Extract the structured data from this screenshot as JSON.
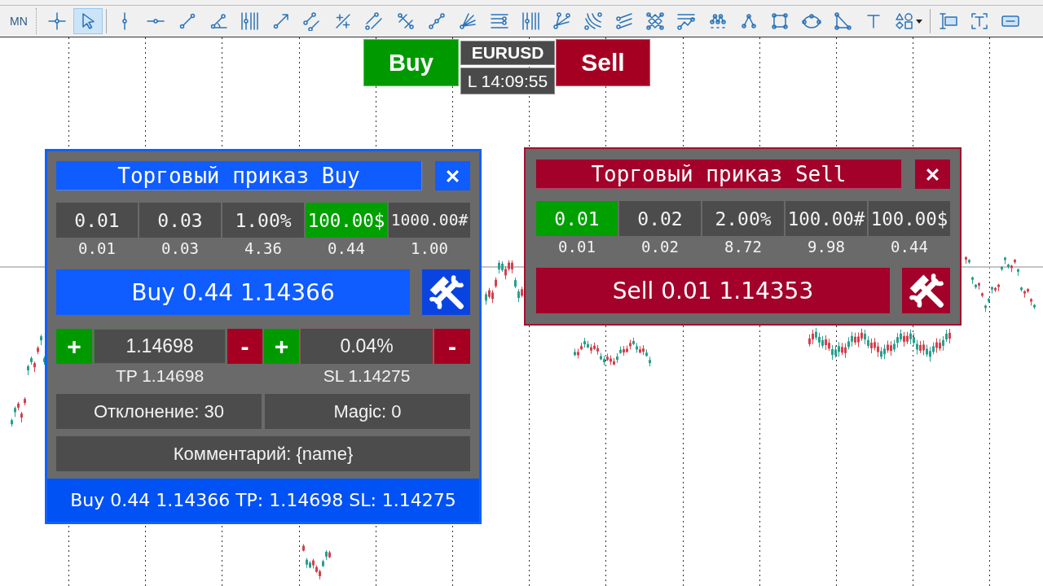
{
  "toolbar": {
    "period": "MN",
    "tool_groups": [
      [
        {
          "kind": "crosshair",
          "selected": false
        },
        {
          "kind": "cursor",
          "selected": true
        }
      ],
      [
        {
          "kind": "vertical-line",
          "selected": false
        },
        {
          "kind": "horizontal-line",
          "selected": false
        },
        {
          "kind": "trend-line",
          "selected": false
        },
        {
          "kind": "angle-line",
          "selected": false
        },
        {
          "kind": "vertical-lines",
          "selected": false
        },
        {
          "kind": "arrow-line",
          "selected": false
        },
        {
          "kind": "parallel-lines",
          "selected": false
        },
        {
          "kind": "plus-lines",
          "selected": false
        },
        {
          "kind": "double-lines",
          "selected": false
        },
        {
          "kind": "crossed-lines",
          "selected": false
        },
        {
          "kind": "three-point-line",
          "selected": false
        },
        {
          "kind": "ray-fan",
          "selected": false
        },
        {
          "kind": "horizontal-lines",
          "selected": false
        },
        {
          "kind": "vertical-lines",
          "selected": false
        },
        {
          "kind": "fan-lines",
          "selected": false
        },
        {
          "kind": "arcs",
          "selected": false
        },
        {
          "kind": "slanted-lines",
          "selected": false
        },
        {
          "kind": "lattice",
          "selected": false
        },
        {
          "kind": "zigzag-lines",
          "selected": false
        },
        {
          "kind": "wave-points",
          "selected": false
        },
        {
          "kind": "triangle-points",
          "selected": false
        },
        {
          "kind": "rectangle",
          "selected": false
        },
        {
          "kind": "ellipse",
          "selected": false
        },
        {
          "kind": "triangle",
          "selected": false
        },
        {
          "kind": "letter-t",
          "selected": false
        },
        {
          "kind": "shapes",
          "selected": false
        }
      ],
      [
        {
          "kind": "label",
          "selected": false
        },
        {
          "kind": "text-frame",
          "selected": false
        },
        {
          "kind": "rounded-box",
          "selected": false
        }
      ]
    ]
  },
  "quick_trade": {
    "buy": "Buy",
    "symbol": "EURUSD",
    "time": "L 14:09:55",
    "sell": "Sell"
  },
  "order_panels": [
    {
      "kind": "buy",
      "title": "Торговый приказ Buy",
      "lots": [
        {
          "label": "0.01",
          "volume": "0.01",
          "selected": false
        },
        {
          "label": "0.03",
          "volume": "0.03",
          "selected": false
        },
        {
          "label": "1.00%",
          "volume": "4.36",
          "selected": false
        },
        {
          "label": "100.00$",
          "volume": "0.44",
          "selected": true
        },
        {
          "label": "1000.00#",
          "volume": "1.00",
          "selected": false
        }
      ],
      "submit": "Buy 0.44 1.14366",
      "take_profit": {
        "plus": "+",
        "value": "1.14698",
        "minus": "-",
        "caption": "TP 1.14698"
      },
      "stop_loss": {
        "plus": "+",
        "value": "0.04%",
        "minus": "-",
        "caption": "SL 1.14275"
      },
      "deviation": "Отклонение: 30",
      "magic": "Magic: 0",
      "comment": "Комментарий: {name}",
      "summary": "Buy 0.44 1.14366 TP: 1.14698 SL: 1.14275"
    },
    {
      "kind": "sell",
      "title": "Торговый приказ Sell",
      "lots": [
        {
          "label": "0.01",
          "volume": "0.01",
          "selected": true
        },
        {
          "label": "0.02",
          "volume": "0.02",
          "selected": false
        },
        {
          "label": "2.00%",
          "volume": "8.72",
          "selected": false
        },
        {
          "label": "100.00#",
          "volume": "9.98",
          "selected": false
        },
        {
          "label": "100.00$",
          "volume": "0.44",
          "selected": false
        }
      ],
      "submit": "Sell 0.01 1.14353"
    }
  ]
}
